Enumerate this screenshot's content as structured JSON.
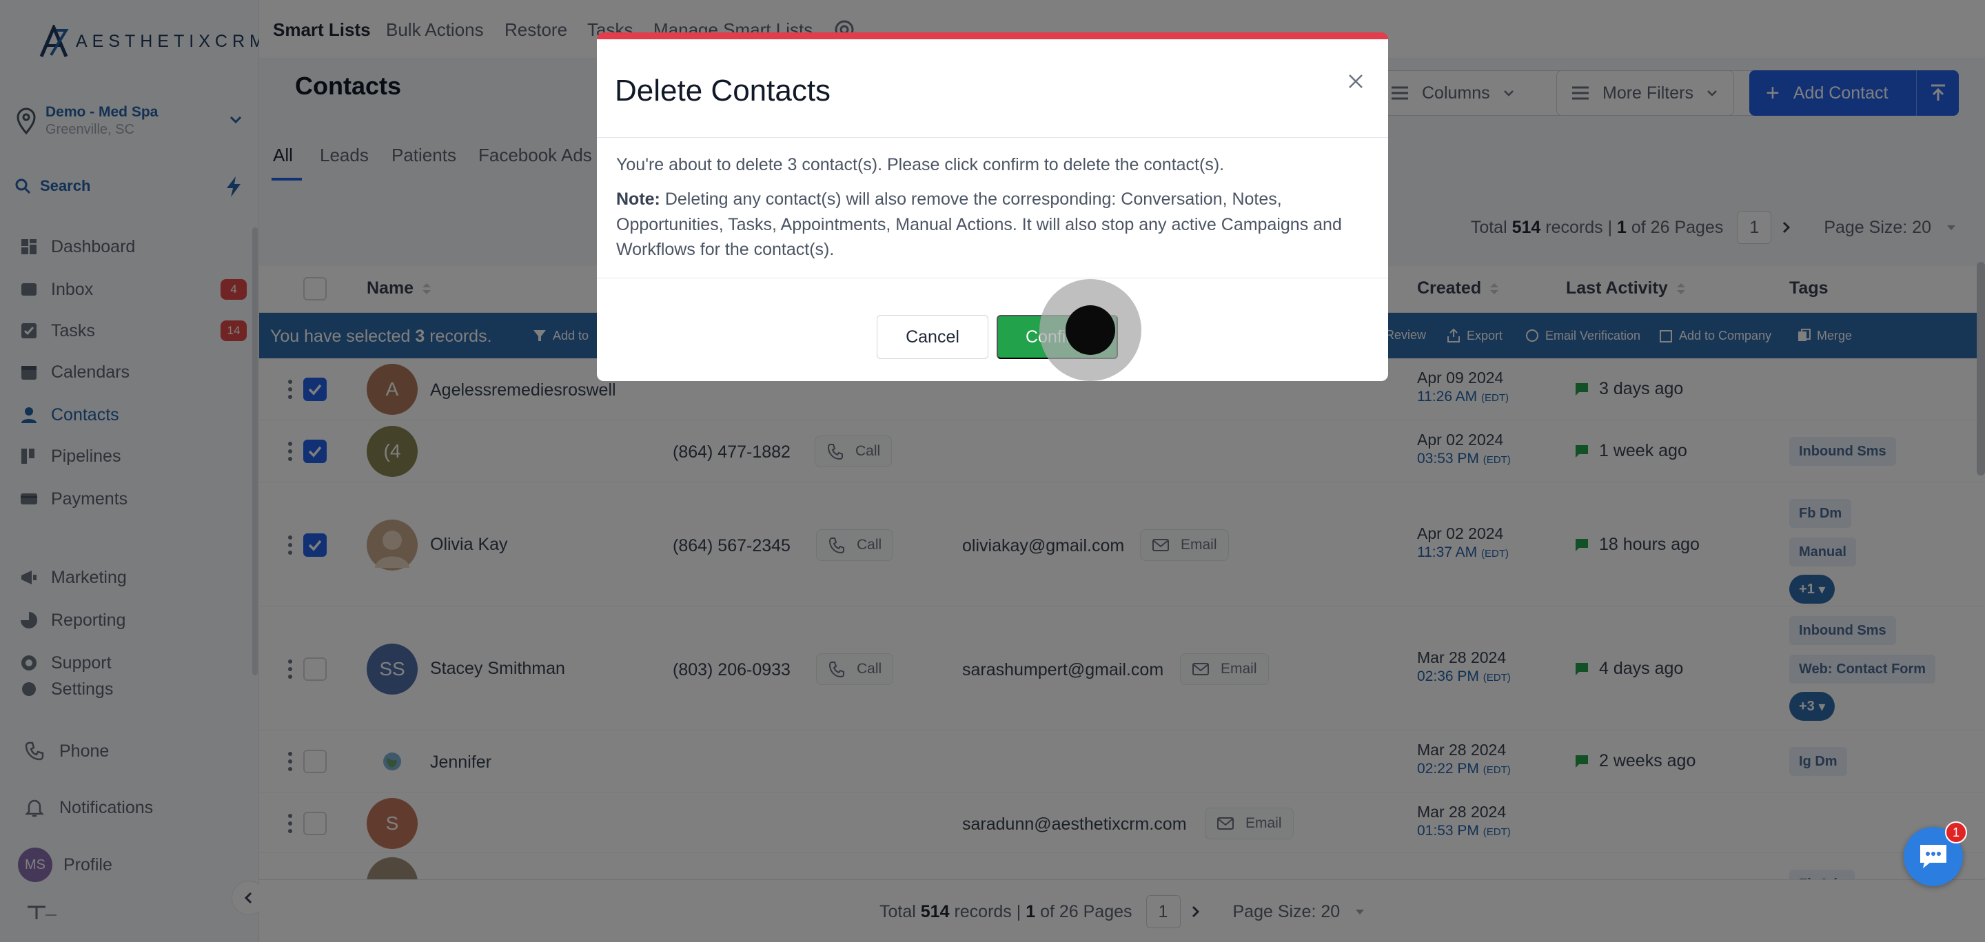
{
  "app": {
    "logo_text": "AESTHETIXCRM"
  },
  "sidebar": {
    "location_name": "Demo - Med Spa",
    "location_city": "Greenville, SC",
    "search_label": "Search",
    "items": [
      {
        "label": "Dashboard",
        "icon": "dashboard-icon"
      },
      {
        "label": "Inbox",
        "icon": "inbox-icon",
        "badge": "4"
      },
      {
        "label": "Tasks",
        "icon": "tasks-icon",
        "badge": "14"
      },
      {
        "label": "Calendars",
        "icon": "calendar-icon"
      },
      {
        "label": "Contacts",
        "icon": "contacts-icon",
        "active": true
      },
      {
        "label": "Pipelines",
        "icon": "pipelines-icon"
      },
      {
        "label": "Payments",
        "icon": "payments-icon"
      },
      {
        "label": "Marketing",
        "icon": "marketing-icon"
      },
      {
        "label": "Reporting",
        "icon": "reporting-icon"
      },
      {
        "label": "Support",
        "icon": "support-icon"
      },
      {
        "label": "Settings",
        "icon": "settings-icon"
      }
    ],
    "phone_label": "Phone",
    "notifications_label": "Notifications",
    "profile_label": "Profile",
    "profile_initials": "MS"
  },
  "topnav": {
    "tabs": [
      "Smart Lists",
      "Bulk Actions",
      "Restore",
      "Tasks",
      "Manage Smart Lists"
    ]
  },
  "page": {
    "title": "Contacts",
    "columns_label": "Columns",
    "more_filters_label": "More Filters",
    "add_contact_label": "Add Contact"
  },
  "list_tabs": [
    "All",
    "Leads",
    "Patients",
    "Facebook Ads"
  ],
  "pager": {
    "total_prefix": "Total",
    "total_records": "514",
    "records_word": "records |",
    "current": "1",
    "of_pages": "of 26 Pages",
    "page_number": "1",
    "page_size_label": "Page Size: 20"
  },
  "table": {
    "headers": {
      "name": "Name",
      "created": "Created",
      "last_activity": "Last Activity",
      "tags": "Tags"
    },
    "selection": {
      "prefix": "You have selected",
      "count": "3",
      "suffix": "records.",
      "actions": [
        "Add to",
        "Review",
        "Export",
        "Email Verification",
        "Add to Company",
        "Merge"
      ]
    },
    "rows": [
      {
        "initials": "A",
        "name": "Agelessremediesroswell",
        "phone": "",
        "email": "",
        "created_date": "Apr 09 2024",
        "created_time": "11:26 AM",
        "tz": "(EDT)",
        "last_activity": "3 days ago",
        "tags": [],
        "checked": true
      },
      {
        "initials": "(4",
        "name": "",
        "phone": "(864) 477-1882",
        "email": "",
        "created_date": "Apr 02 2024",
        "created_time": "03:53 PM",
        "tz": "(EDT)",
        "last_activity": "1 week ago",
        "tags": [
          "Inbound Sms"
        ],
        "checked": true
      },
      {
        "initials": "",
        "name": "Olivia Kay",
        "phone": "(864) 567-2345",
        "email": "oliviakay@gmail.com",
        "created_date": "Apr 02 2024",
        "created_time": "11:37 AM",
        "tz": "(EDT)",
        "last_activity": "18 hours ago",
        "tags": [
          "Fb Dm",
          "Manual",
          "+1"
        ],
        "checked": true
      },
      {
        "initials": "SS",
        "name": "Stacey Smithman",
        "phone": "(803) 206-0933",
        "email": "sarashumpert@gmail.com",
        "created_date": "Mar 28 2024",
        "created_time": "02:36 PM",
        "tz": "(EDT)",
        "last_activity": "4 days ago",
        "tags": [
          "Inbound Sms",
          "Web: Contact Form",
          "+3"
        ],
        "checked": false
      },
      {
        "initials": "",
        "name": "Jennifer",
        "phone": "",
        "email": "",
        "created_date": "Mar 28 2024",
        "created_time": "02:22 PM",
        "tz": "(EDT)",
        "last_activity": "2 weeks ago",
        "tags": [
          "Ig Dm"
        ],
        "checked": false
      },
      {
        "initials": "S",
        "name": "",
        "phone": "",
        "email": "saradunn@aesthetixcrm.com",
        "created_date": "Mar 28 2024",
        "created_time": "01:53 PM",
        "tz": "(EDT)",
        "last_activity": "",
        "tags": [],
        "checked": false
      }
    ],
    "partial_tag": "Fb Ads",
    "call_label": "Call",
    "email_label": "Email"
  },
  "modal": {
    "title": "Delete Contacts",
    "message": "You're about to delete 3 contact(s). Please click confirm to delete the contact(s).",
    "note_label": "Note:",
    "note_text": " Deleting any contact(s) will also remove the corresponding: Conversation, Notes, Opportunities, Tasks, Appointments, Manual Actions. It will also stop any active Campaigns and Workflows for the contact(s).",
    "cancel_label": "Cancel",
    "confirm_label": "Confirm"
  },
  "chat": {
    "badge": "1"
  },
  "colors": {
    "primary": "#2563eb",
    "danger_bar": "#e23d4b",
    "confirm_green": "#22a24b",
    "selection_bar": "#2f6ba8"
  }
}
